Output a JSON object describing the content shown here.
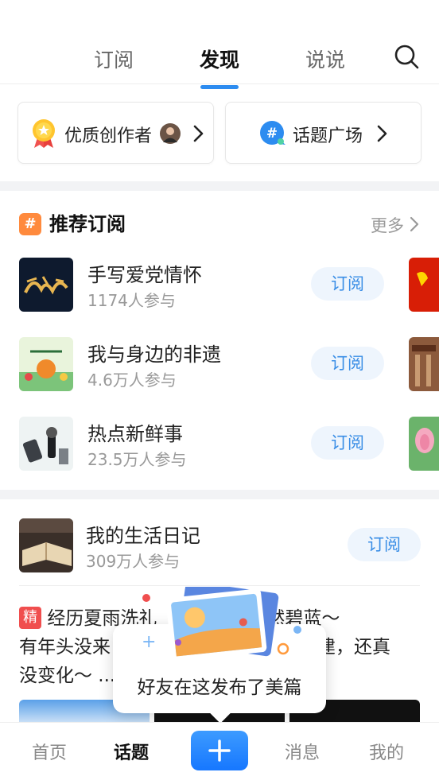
{
  "top_tabs": [
    "订阅",
    "发现",
    "说说"
  ],
  "active_tab": "发现",
  "quick_cards": [
    {
      "label": "优质创作者",
      "icon": "medal-icon"
    },
    {
      "label": "话题广场",
      "icon": "hash-bubble-icon"
    }
  ],
  "recommend": {
    "title": "推荐订阅",
    "more": "更多",
    "badge": "#",
    "items": [
      {
        "name": "手写爱党情怀",
        "count": "1174人参与",
        "button": "订阅"
      },
      {
        "name": "我与身边的非遗",
        "count": "4.6万人参与",
        "button": "订阅"
      },
      {
        "name": "热点新鲜事",
        "count": "23.5万人参与",
        "button": "订阅"
      }
    ]
  },
  "feed_topic": {
    "name": "我的生活日记",
    "count": "309万人参与",
    "button": "订阅"
  },
  "article": {
    "badge": "精",
    "line1": "经历夏雨洗礼",
    "line1_end": "然碧蓝～",
    "line2_start": "有年头没来",
    "line2_end": "建，还真",
    "line3": "没变化～ ..."
  },
  "tooltip": {
    "text": "好友在这发布了美篇"
  },
  "bottom_nav": {
    "home": "首页",
    "topics": "话题",
    "messages": "消息",
    "mine": "我的"
  },
  "colors": {
    "accent": "#2d8cf0",
    "subscribe_bg": "#eef5fd",
    "badge_orange": "#ff8a3d",
    "jing_red": "#f04e4e"
  }
}
